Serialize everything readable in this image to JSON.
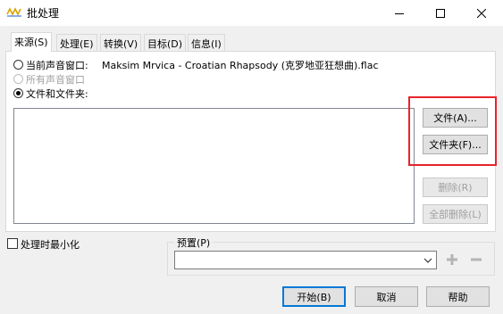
{
  "window": {
    "title": "批处理",
    "icon": "waveform-icon",
    "controls": [
      "minimize-icon",
      "maximize-icon",
      "close-icon"
    ]
  },
  "tabs": [
    {
      "label": "来源(S)",
      "active": true
    },
    {
      "label": "处理(E)",
      "active": false
    },
    {
      "label": "转换(V)",
      "active": false
    },
    {
      "label": "目标(D)",
      "active": false
    },
    {
      "label": "信息(I)",
      "active": false
    }
  ],
  "source": {
    "current_window_label": "当前声音窗口:",
    "current_window_file": "Maksim Mrvica - Croatian Rhapsody (克罗地亚狂想曲).flac",
    "all_windows_label": "所有声音窗口",
    "files_folders_label": "文件和文件夹:",
    "selected_option": "files_folders"
  },
  "buttons": {
    "file": "文件(A)...",
    "folder": "文件夹(F)...",
    "delete": "删除(R)",
    "delete_all": "全部删除(L)",
    "start": "开始(B)",
    "cancel": "取消",
    "help": "帮助"
  },
  "minimize_when_processing": {
    "label": "处理时最小化",
    "checked": false
  },
  "preset": {
    "group_label": "预置(P)",
    "value": "",
    "add_icon": "plus-icon",
    "remove_icon": "minus-icon"
  },
  "colors": {
    "highlight": "#e8242a",
    "accent": "#0078d7"
  }
}
